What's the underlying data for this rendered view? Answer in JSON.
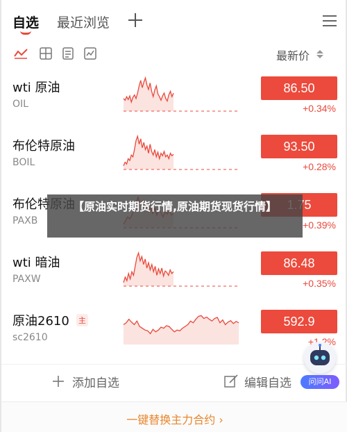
{
  "tabs": {
    "active": "自选",
    "inactive": "最近浏览"
  },
  "toolbar": {
    "sort_label": "最新价"
  },
  "colors": {
    "accent": "#e8493b",
    "price_bg": "#ec4a3c",
    "chart_line": "#e8493b",
    "chart_fill": "#fbe3e0",
    "banner_text": "#e8862c"
  },
  "rows": [
    {
      "name": "wti 原油",
      "code": "OIL",
      "tag": "",
      "price": "86.50",
      "change": "+0.34%",
      "spark": [
        0.35,
        0.3,
        0.4,
        0.32,
        0.42,
        0.25,
        0.38,
        0.45,
        0.35,
        0.5,
        0.7,
        0.85,
        0.65,
        0.8,
        0.92,
        0.72,
        0.6,
        0.78,
        0.55,
        0.4,
        0.58,
        0.7,
        0.48,
        0.4,
        0.3,
        0.42,
        0.5,
        0.35,
        0.28,
        0.45,
        0.55,
        0.4,
        0.5
      ]
    },
    {
      "name": "布伦特原油",
      "code": "BOIL",
      "tag": "",
      "price": "93.50",
      "change": "+0.28%",
      "spark": [
        0.1,
        0.2,
        0.15,
        0.3,
        0.25,
        0.4,
        0.35,
        0.55,
        0.8,
        0.92,
        0.7,
        0.85,
        0.6,
        0.75,
        0.55,
        0.65,
        0.45,
        0.7,
        0.5,
        0.4,
        0.55,
        0.35,
        0.48,
        0.3,
        0.45,
        0.38,
        0.5,
        0.35,
        0.4,
        0.3,
        0.45,
        0.38,
        0.42
      ]
    },
    {
      "name": "布伦特原油",
      "code": "PAXB",
      "tag": "",
      "price": "1.75",
      "change": "+0.39%",
      "spark": [
        0.1,
        0.2,
        0.3,
        0.25,
        0.35,
        0.5,
        0.7,
        0.85,
        0.65,
        0.75,
        0.55,
        0.68,
        0.45,
        0.6,
        0.4,
        0.55,
        0.35,
        0.5,
        0.42,
        0.3,
        0.45,
        0.38,
        0.5,
        0.35,
        0.4
      ]
    },
    {
      "name": "wti 暗油",
      "code": "PAXW",
      "tag": "",
      "price": "86.48",
      "change": "+0.35%",
      "spark": [
        0.1,
        0.25,
        0.15,
        0.35,
        0.2,
        0.4,
        0.3,
        0.55,
        0.8,
        0.92,
        0.7,
        0.82,
        0.6,
        0.75,
        0.5,
        0.65,
        0.45,
        0.6,
        0.4,
        0.55,
        0.3,
        0.48,
        0.35,
        0.5,
        0.28,
        0.42,
        0.38,
        0.3,
        0.45,
        0.35,
        0.4
      ]
    },
    {
      "name": "原油2610",
      "code": "sc2610",
      "tag": "主",
      "price": "592.9",
      "change": "+1.2%",
      "spark": [
        0.55,
        0.6,
        0.7,
        0.62,
        0.55,
        0.65,
        0.5,
        0.45,
        0.4,
        0.38,
        0.3,
        0.42,
        0.35,
        0.4,
        0.48,
        0.45,
        0.52,
        0.5,
        0.42,
        0.35,
        0.4,
        0.38,
        0.45,
        0.5,
        0.55,
        0.65,
        0.6,
        0.7,
        0.78,
        0.8,
        0.72,
        0.76,
        0.7,
        0.65,
        0.72,
        0.75,
        0.6,
        0.68,
        0.55,
        0.62,
        0.66,
        0.58,
        0.64,
        0.6
      ]
    }
  ],
  "actions": {
    "add": "添加自选",
    "edit": "编辑自选"
  },
  "ai_badge": "问问AI",
  "banner": "一键替换主力合约",
  "overlay": "【原油实时期货行情,原油期货现货行情】"
}
